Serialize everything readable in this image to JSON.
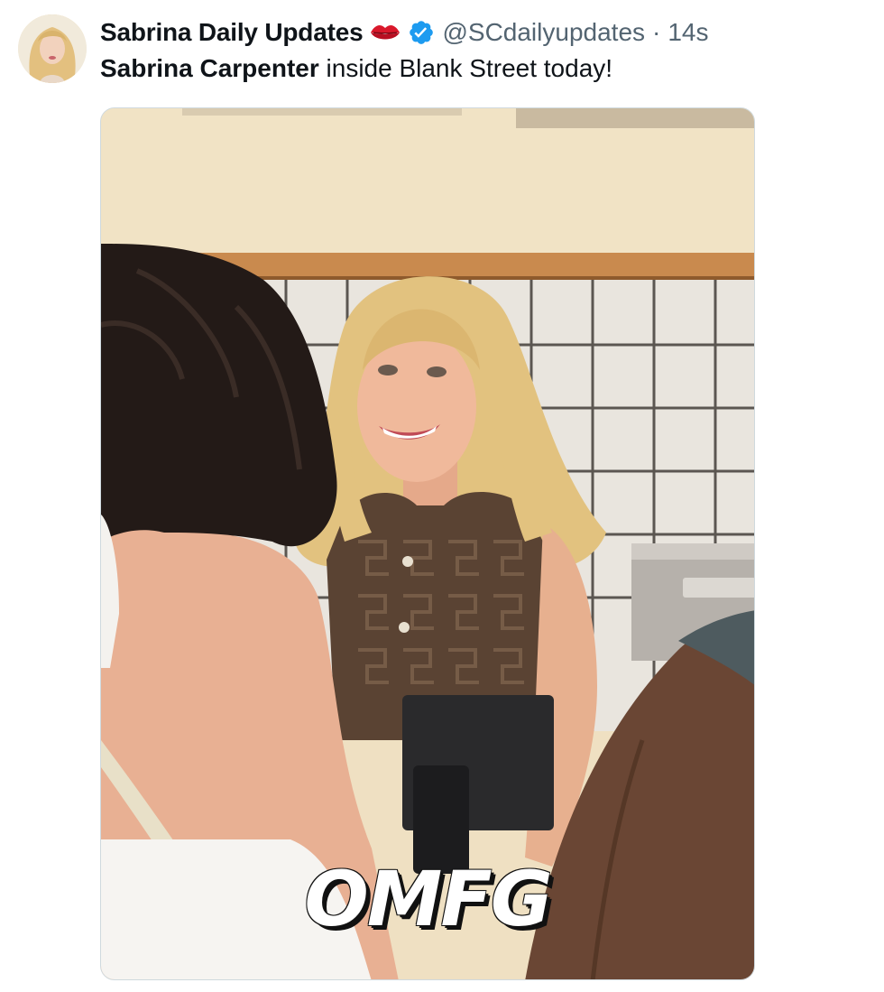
{
  "tweet": {
    "display_name": "Sabrina Daily Updates",
    "name_emoji_icon": "lips-icon",
    "verified_icon": "verified-badge-icon",
    "handle": "@SCdailyupdates",
    "separator": "·",
    "time": "14s",
    "text_bold": "Sabrina Carpenter",
    "text_rest": " inside Blank Street today!",
    "media": {
      "caption": "OMFG"
    }
  },
  "colors": {
    "verified": "#1d9bf0",
    "secondary_text": "#536471",
    "lips": "#d9182b"
  }
}
